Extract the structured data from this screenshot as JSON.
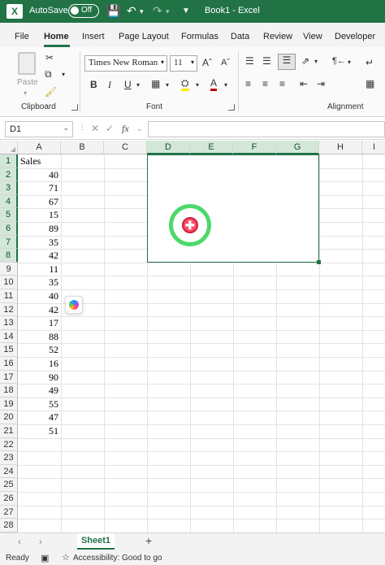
{
  "titlebar": {
    "autosave_label": "AutoSave",
    "autosave_state": "Off",
    "doc_title": "Book1  -  Excel"
  },
  "menu": {
    "tabs": [
      "File",
      "Home",
      "Insert",
      "Page Layout",
      "Formulas",
      "Data",
      "Review",
      "View",
      "Developer"
    ],
    "active": "Home"
  },
  "ribbon": {
    "font_name": "Times New Roman",
    "font_size": "11",
    "paste_label": "Paste",
    "groups": [
      "Clipboard",
      "Font",
      "Alignment"
    ],
    "bold": "B",
    "italic": "I",
    "underline": "U"
  },
  "formula_bar": {
    "name_box": "D1",
    "formula": ""
  },
  "grid": {
    "columns": [
      "A",
      "B",
      "C",
      "D",
      "E",
      "F",
      "G",
      "H"
    ],
    "rows": [
      "1",
      "2",
      "3",
      "4",
      "5",
      "6",
      "7",
      "8",
      "9",
      "10",
      "11",
      "12",
      "13",
      "14",
      "15",
      "16",
      "17",
      "18",
      "19",
      "20",
      "21",
      "22",
      "23",
      "24",
      "25",
      "26",
      "27",
      "28"
    ],
    "header_cell": "Sales",
    "values": [
      "40",
      "71",
      "67",
      "15",
      "89",
      "35",
      "42",
      "11",
      "35",
      "40",
      "42",
      "17",
      "88",
      "52",
      "16",
      "90",
      "49",
      "55",
      "47",
      "51"
    ]
  },
  "sheets": {
    "tabs": [
      "Sheet1"
    ],
    "add": "+"
  },
  "status": {
    "ready": "Ready",
    "accessibility": "Accessibility: Good to go"
  },
  "colors": {
    "accent": "#217346",
    "cursor_ring": "#4cd86a",
    "cursor_dot": "#ff4d6a"
  }
}
